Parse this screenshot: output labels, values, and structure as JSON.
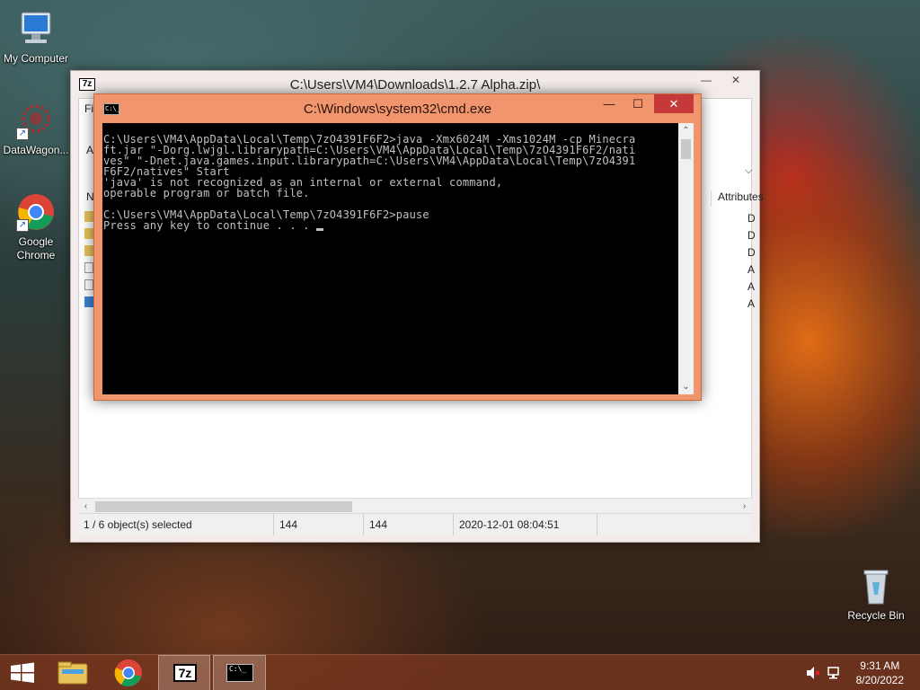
{
  "desktop": {
    "icons": [
      {
        "label": "My Computer"
      },
      {
        "label": "DataWagon..."
      },
      {
        "label": "Google Chrome"
      },
      {
        "label": "Recycle Bin"
      }
    ]
  },
  "archive_window": {
    "title": "C:\\Users\\VM4\\Downloads\\1.2.7 Alpha.zip\\",
    "app_icon": "7z",
    "menu_fragment": "Fi",
    "toolbar_fragment": "A",
    "column_name_fragment": "N",
    "column_attributes": "Attributes",
    "attribute_fragments": [
      "D",
      "D",
      "D",
      "A",
      "A",
      "A"
    ],
    "status": {
      "selection": "1 / 6 object(s) selected",
      "size": "144",
      "packed_size": "144",
      "modified": "2020-12-01 08:04:51"
    },
    "controls": {
      "minimize": "—",
      "close": "✕"
    }
  },
  "cmd_window": {
    "title": "C:\\Windows\\system32\\cmd.exe",
    "icon_text": "C:\\_",
    "controls": {
      "minimize": "—",
      "maximize": "☐",
      "close": "✕"
    },
    "lines": [
      "C:\\Users\\VM4\\AppData\\Local\\Temp\\7zO4391F6F2>java -Xmx6024M -Xms1024M -cp Minecra",
      "ft.jar \"-Dorg.lwjgl.librarypath=C:\\Users\\VM4\\AppData\\Local\\Temp\\7zO4391F6F2/nati",
      "ves\" \"-Dnet.java.games.input.librarypath=C:\\Users\\VM4\\AppData\\Local\\Temp\\7zO4391",
      "F6F2/natives\" Start",
      "'java' is not recognized as an internal or external command,",
      "operable program or batch file.",
      "",
      "C:\\Users\\VM4\\AppData\\Local\\Temp\\7zO4391F6F2>pause",
      "Press any key to continue . . . "
    ]
  },
  "taskbar": {
    "time": "9:31 AM",
    "date": "8/20/2022",
    "pinned": [
      {
        "icon": "windows-start-icon"
      },
      {
        "icon": "file-explorer-icon"
      },
      {
        "icon": "chrome-icon"
      },
      {
        "icon": "7zip-icon",
        "label": "7z"
      },
      {
        "icon": "cmd-icon",
        "label": "C:\\_"
      }
    ],
    "tray": [
      {
        "icon": "volume-muted-icon"
      },
      {
        "icon": "network-icon"
      }
    ]
  }
}
